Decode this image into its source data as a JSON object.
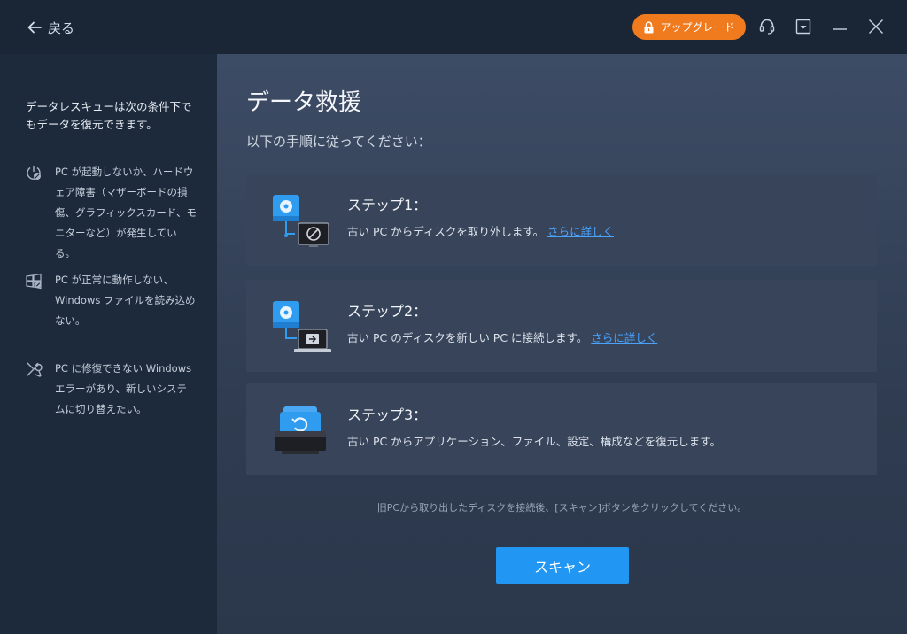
{
  "header": {
    "back_label": "戻る",
    "upgrade_label": "アップグレード"
  },
  "sidebar": {
    "intro": "データレスキューは次の条件下でもデータを復元できます。",
    "items": [
      {
        "icon": "power-disk-icon",
        "text": "PC が起動しないか、ハードウェア障害（マザーボードの損傷、グラフィックスカード、モニターなど）が発生している。"
      },
      {
        "icon": "broken-windows-icon",
        "text": "PC が正常に動作しない、Windows ファイルを読み込めない。"
      },
      {
        "icon": "tools-icon",
        "text": "PC に修復できない Windows エラーがあり、新しいシステムに切り替えたい。"
      }
    ]
  },
  "main": {
    "title": "データ救援",
    "subtitle": "以下の手順に従ってください：",
    "steps": [
      {
        "title": "ステップ1：",
        "desc": "古い PC からディスクを取り外します。",
        "link": "さらに詳しく"
      },
      {
        "title": "ステップ2：",
        "desc": "古い PC のディスクを新しい PC に接続します。",
        "link": "さらに詳しく"
      },
      {
        "title": "ステップ3：",
        "desc": "古い PC からアプリケーション、ファイル、設定、構成などを復元します。"
      }
    ],
    "hint": "旧PCから取り出したディスクを接続後、[スキャン]ボタンをクリックしてください。",
    "scan_label": "スキャン"
  },
  "colors": {
    "accent": "#2196f3",
    "upgrade": "#f07a1e",
    "link": "#4aa3ff"
  }
}
